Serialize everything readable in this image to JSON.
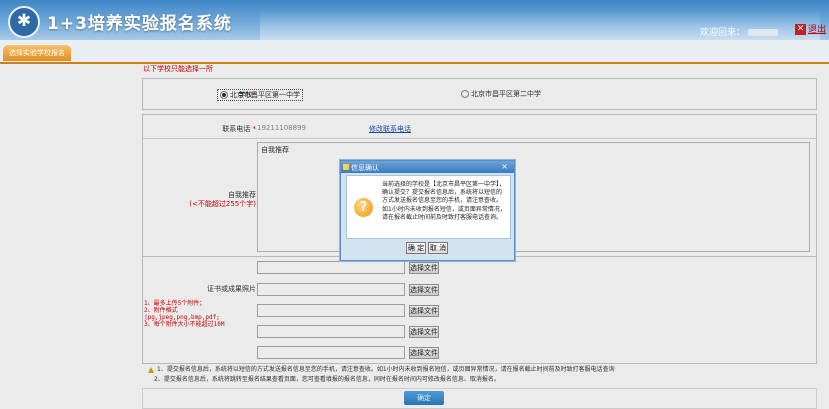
{
  "header": {
    "logo_glyph": "✱",
    "title": "1+3培养实验报名系统",
    "welcome": "欢迎回来：",
    "logout": "退出",
    "logout_icon": "close-icon"
  },
  "tab": {
    "label": "选择实验学校报名"
  },
  "form": {
    "note": "以下学校只能选择一所",
    "school_label": "学校",
    "required_mark": "*",
    "school_options": [
      {
        "label": "北京市昌平区第一中学",
        "selected": true
      },
      {
        "label": "北京市昌平区第二中学",
        "selected": false
      }
    ],
    "phone_label": "联系电话",
    "phone_value": "19211108899",
    "edit_phone_link": "修改联系电话",
    "self_rec_label": "自我推荐",
    "self_rec_hint": "(<不能超过255个字)",
    "self_rec_placeholder": "自我推荐",
    "cert_label": "证书或成果照片",
    "upload_button": "选择文件",
    "upload_rules": [
      "1、最多上传5个附件；",
      "2、附件格式",
      "jpg,jpeg,png,bmp,pdf;",
      "3、每个附件大小不能超过10M"
    ],
    "footnotes": [
      "1、提交报名信息后，系统将以短信的方式发送报名信息至您的手机，请注意查收。如1小时内未收到报名短信，或页面异常情况，请在报名截止时间前及时致打客服电话查询",
      "2、提交报名信息后，系统将跳转至报名结果查看页面，您可查看填报的报名信息，同时在报名时间内可修改报名信息、取消报名。"
    ],
    "submit": "确定"
  },
  "dialog": {
    "title": "信息确认",
    "close": "×",
    "message": "当前选择的学校是【北京市昌平区第一中学】，确认提交？提交报名信息后，系统将以短信的方式发送报名信息至您的手机，请注意查收。如1小时内未收到报名短信，或页面异常情况，请在报名截止时间前及时致打客服电话查询。",
    "icon": "question-icon",
    "ok": "确 定",
    "cancel": "取 消"
  },
  "colors": {
    "header_blue": "#3f86c6",
    "tab_orange": "#e48e1e",
    "required_red": "#d40000",
    "link_blue": "#1a4fb5"
  }
}
